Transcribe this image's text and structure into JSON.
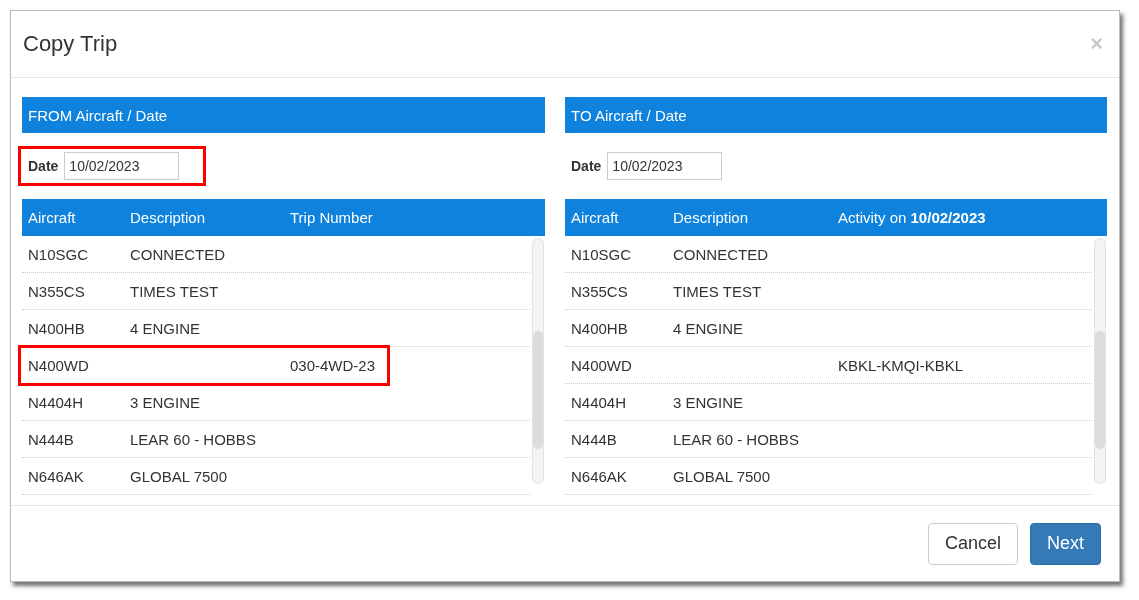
{
  "dialog": {
    "title": "Copy Trip",
    "close": "×"
  },
  "panels": [
    {
      "title": "FROM Aircraft / Date",
      "date_label": "Date",
      "date": "10/02/2023",
      "date_highlighted": true,
      "columns": [
        "Aircraft",
        "Description",
        "Trip Number"
      ],
      "rows": [
        {
          "aircraft": "N10SGC",
          "description": "CONNECTED",
          "info": "",
          "highlighted": false
        },
        {
          "aircraft": "N355CS",
          "description": "TIMES TEST",
          "info": "",
          "highlighted": false
        },
        {
          "aircraft": "N400HB",
          "description": "4 ENGINE",
          "info": "",
          "highlighted": false
        },
        {
          "aircraft": "N400WD",
          "description": "",
          "info": "030-4WD-23",
          "highlighted": true
        },
        {
          "aircraft": "N4404H",
          "description": "3 ENGINE",
          "info": "",
          "highlighted": false
        },
        {
          "aircraft": "N444B",
          "description": "LEAR 60 - HOBBS",
          "info": "",
          "highlighted": false
        },
        {
          "aircraft": "N646AK",
          "description": "GLOBAL 7500",
          "info": "",
          "highlighted": false
        }
      ]
    },
    {
      "title": "TO Aircraft / Date",
      "date_label": "Date",
      "date": "10/02/2023",
      "date_highlighted": false,
      "columns": [
        "Aircraft",
        "Description",
        "Activity on **10/02/2023**"
      ],
      "rows": [
        {
          "aircraft": "N10SGC",
          "description": "CONNECTED",
          "info": "",
          "highlighted": false
        },
        {
          "aircraft": "N355CS",
          "description": "TIMES TEST",
          "info": "",
          "highlighted": false
        },
        {
          "aircraft": "N400HB",
          "description": "4 ENGINE",
          "info": "",
          "highlighted": false
        },
        {
          "aircraft": "N400WD",
          "description": "",
          "info": "KBKL-KMQI-KBKL",
          "highlighted": false
        },
        {
          "aircraft": "N4404H",
          "description": "3 ENGINE",
          "info": "",
          "highlighted": false
        },
        {
          "aircraft": "N444B",
          "description": "LEAR 60 - HOBBS",
          "info": "",
          "highlighted": false
        },
        {
          "aircraft": "N646AK",
          "description": "GLOBAL 7500",
          "info": "",
          "highlighted": false
        }
      ]
    }
  ],
  "buttons": [
    {
      "label": "Cancel",
      "kind": "secondary"
    },
    {
      "label": "Next",
      "kind": "primary"
    }
  ]
}
